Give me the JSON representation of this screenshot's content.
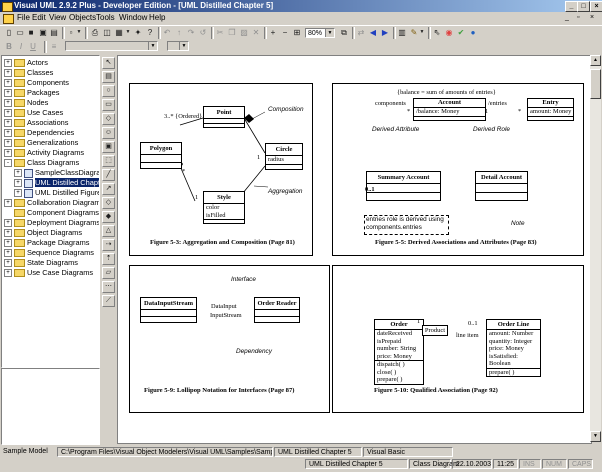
{
  "window": {
    "title": "Visual UML 2.9.2 Plus - Developer Edition - [UML Distilled Chapter 5]"
  },
  "menu": [
    "File",
    "Edit",
    "View",
    "Objects",
    "Tools",
    "Window",
    "Help"
  ],
  "toolbar": {
    "zoom": "80%"
  },
  "tree": {
    "items": [
      {
        "label": "Actors",
        "toggle": "+"
      },
      {
        "label": "Classes",
        "toggle": "+"
      },
      {
        "label": "Components",
        "toggle": "+"
      },
      {
        "label": "Packages",
        "toggle": "+"
      },
      {
        "label": "Nodes",
        "toggle": "+"
      },
      {
        "label": "Use Cases",
        "toggle": "+"
      },
      {
        "label": "Associations",
        "toggle": "+"
      },
      {
        "label": "Dependencies",
        "toggle": "+"
      },
      {
        "label": "Generalizations",
        "toggle": "+"
      },
      {
        "label": "Activity Diagrams",
        "toggle": "+"
      },
      {
        "label": "Class Diagrams",
        "toggle": "-"
      },
      {
        "label": "SampleClassDiagram1",
        "toggle": "+"
      },
      {
        "label": "UML Distilled Chapter",
        "toggle": "+"
      },
      {
        "label": "UML Distilled Figure 4",
        "toggle": "+"
      },
      {
        "label": "Collaboration Diagrams",
        "toggle": "+"
      },
      {
        "label": "Component Diagrams",
        "toggle": ""
      },
      {
        "label": "Deployment Diagrams",
        "toggle": "+"
      },
      {
        "label": "Object Diagrams",
        "toggle": "+"
      },
      {
        "label": "Package Diagrams",
        "toggle": "+"
      },
      {
        "label": "Sequence Diagrams",
        "toggle": "+"
      },
      {
        "label": "State Diagrams",
        "toggle": "+"
      },
      {
        "label": "Use Case Diagrams",
        "toggle": "+"
      }
    ]
  },
  "fig53": {
    "caption": "Figure 5-3: Aggregation and Composition (Page 81)",
    "point": {
      "name": "Point"
    },
    "polygon": {
      "name": "Polygon"
    },
    "circle": {
      "name": "Circle",
      "attr": "radius"
    },
    "style": {
      "name": "Style",
      "attrs": [
        "color",
        "isFilled"
      ]
    },
    "mult_ordered": "3..* {Ordered}",
    "mult_star": "*",
    "mult_one_a": "1",
    "mult_one_b": "1",
    "composition": "Composition",
    "aggregation": "Aggregation"
  },
  "fig55": {
    "caption": "Figure 5-5: Derived Associations and Attributes (Page 83)",
    "constraint": "{balance = sum of amounts of entries}",
    "account": {
      "name": "Account",
      "attr": "/balance: Money"
    },
    "entry": {
      "name": "Entry",
      "attr": "amount: Money"
    },
    "summary": {
      "name": "Summary Account"
    },
    "detail": {
      "name": "Detail Account"
    },
    "components": "components",
    "entries": "/entries",
    "derived_attr": "Derived Attribute",
    "derived_role": "Derived Role",
    "star1": "*",
    "star2": "*",
    "one": "1",
    "zero_one": "0..1",
    "note_text": [
      "entries role is derived using",
      "components.entries"
    ],
    "note_label": "Note"
  },
  "fig59": {
    "caption": "Figure 5-9: Lollipop Notation for Interfaces (Page 87)",
    "dis": "DataInputStream",
    "reader": "Order Reader",
    "iface1": "DataInput",
    "iface2": "InputStream",
    "interface": "Interface",
    "dependency": "Dependency"
  },
  "fig510": {
    "caption": "Figure 5-10: Qualified Association (Page 92)",
    "order": {
      "name": "Order",
      "attrs": [
        "dateReceived",
        "isPrepaid",
        "number: String",
        "price: Money"
      ],
      "ops": [
        "dispatch( )",
        "close( )",
        "prepare( )"
      ]
    },
    "qualifier": "Product",
    "line_item": "line item",
    "mult": "0..1",
    "one": "1",
    "orderline": {
      "name": "Order Line",
      "attrs": [
        "amount: Number",
        "quantity: Integer",
        "price: Money",
        "isSatisfied: Boolean"
      ],
      "ops": [
        "prepare( )"
      ]
    }
  },
  "status": {
    "model": "Sample Model",
    "path": "C:\\Program Files\\Visual Object Modelers\\Visual UML\\Samples\\Sample.Uml",
    "diagram": "UML Distilled Chapter 5",
    "lang": "Visual Basic",
    "diagram2": "UML Distilled Chapter 5",
    "dtype": "Class Diagram",
    "date": "22.10.2003",
    "time": "11:25",
    "ins": "INS",
    "num": "NUM",
    "caps": "CAPS"
  }
}
